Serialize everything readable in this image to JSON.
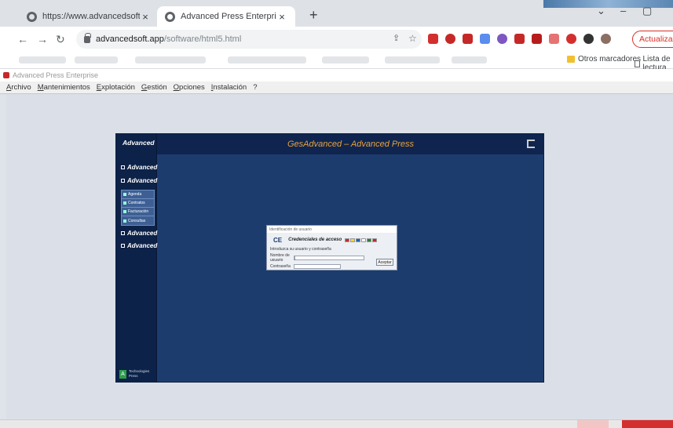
{
  "browser": {
    "tabs": [
      {
        "title": "https://www.advancedsoft.app/",
        "active": false
      },
      {
        "title": "Advanced Press Enterprise",
        "active": true
      }
    ],
    "url_host": "advancedsoft.app",
    "url_path": "/software/html5.html",
    "update_label": "Actualizar",
    "bookmarks_folder": "Otros marcadores",
    "reading_list": "Lista de lectura"
  },
  "app_window": {
    "title": "Advanced Press Enterprise",
    "menus": [
      "Archivo",
      "Mantenimientos",
      "Explotación",
      "Gestión",
      "Opciones",
      "Instalación",
      "?"
    ]
  },
  "web_app": {
    "header_title": "GesAdvanced – Advanced Press",
    "logo": "Advanced",
    "side_logos": [
      "Advanced",
      "Advanced",
      "Advanced",
      "Advanced"
    ],
    "submenu": [
      "Agenda",
      "Contratos",
      "Facturación",
      "Consultas"
    ],
    "footer_text": "Technologies Press"
  },
  "dialog": {
    "title": "Identificación de usuario",
    "logo": "CE",
    "heading": "Credenciales de acceso",
    "message": "Introduzca su usuario y contraseña",
    "user_label": "Nombre de usuario",
    "password_label": "Contraseña",
    "user_value": "|",
    "accept_label": "Aceptar"
  },
  "colors": {
    "app_bg": "#1d3c6e",
    "app_title": "#e8a23a",
    "update": "#d93025"
  }
}
